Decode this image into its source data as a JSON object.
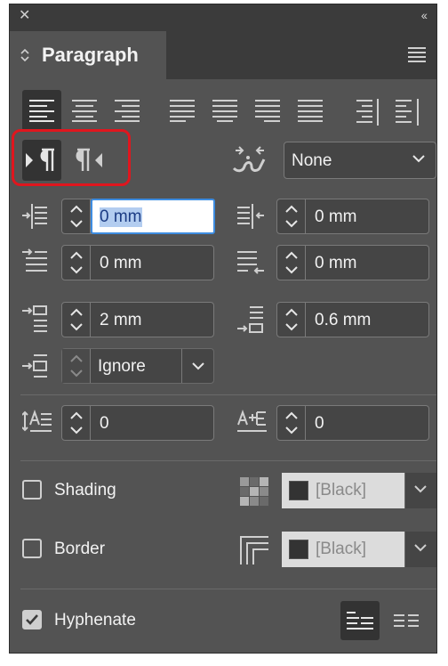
{
  "window": {
    "close_glyph": "✕",
    "collapse_glyph": "‹‹"
  },
  "tab": {
    "chevrons": "◇",
    "title": "Paragraph"
  },
  "alignment": {
    "buttons": [
      "align-left",
      "align-center",
      "align-right",
      "justify-left",
      "justify-center",
      "justify-right",
      "justify-all",
      "align-towards-spine",
      "align-away-from-spine"
    ],
    "active": "align-left"
  },
  "direction": {
    "active": "left-to-right",
    "options": [
      "left-to-right",
      "right-to-left"
    ]
  },
  "script": {
    "selected": "None"
  },
  "indents": {
    "left": "0 mm",
    "right": "0 mm",
    "first_line": "0 mm",
    "last_line": "0 mm"
  },
  "spacing": {
    "before": "2 mm",
    "after": "0.6 mm",
    "grid_align": "Ignore"
  },
  "dropcap": {
    "lines": "0",
    "chars": "0"
  },
  "shading": {
    "label": "Shading",
    "checked": false,
    "swatch": "[Black]"
  },
  "border": {
    "label": "Border",
    "checked": false,
    "swatch": "[Black]"
  },
  "hyphenate": {
    "label": "Hyphenate",
    "checked": true
  },
  "colors": {
    "panel": "#535353",
    "dark": "#3b3b3b",
    "accent_focus": "#3d8ce0",
    "highlight": "#e0161e"
  }
}
